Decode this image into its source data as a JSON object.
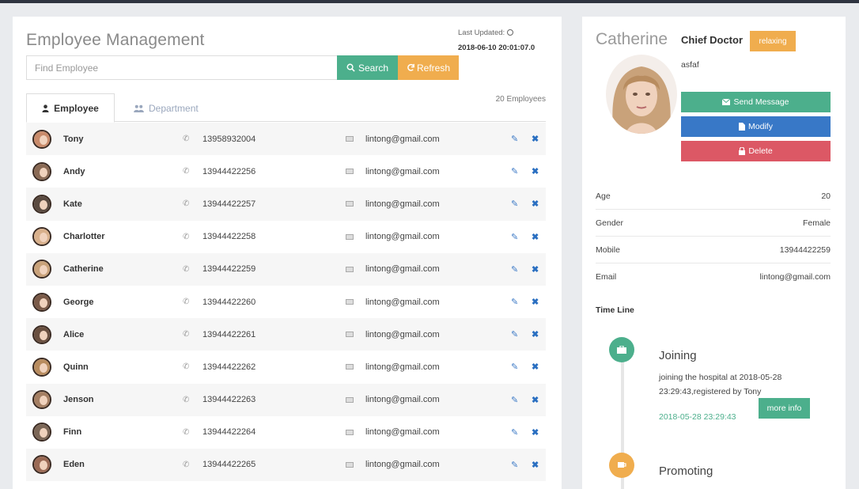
{
  "header": {
    "title": "Employee Management",
    "last_updated_label": "Last Updated:",
    "last_updated_time": "2018-06-10 20:01:07.0"
  },
  "search": {
    "placeholder": "Find Employee",
    "search_label": "Search",
    "refresh_label": "Refresh"
  },
  "tabs": {
    "employee": "Employee",
    "department": "Department",
    "count": "20 Employees"
  },
  "employees": [
    {
      "name": "Tony",
      "phone": "13958932004",
      "email": "lintong@gmail.com"
    },
    {
      "name": "Andy",
      "phone": "13944422256",
      "email": "lintong@gmail.com"
    },
    {
      "name": "Kate",
      "phone": "13944422257",
      "email": "lintong@gmail.com"
    },
    {
      "name": "Charlotter",
      "phone": "13944422258",
      "email": "lintong@gmail.com"
    },
    {
      "name": "Catherine",
      "phone": "13944422259",
      "email": "lintong@gmail.com"
    },
    {
      "name": "George",
      "phone": "13944422260",
      "email": "lintong@gmail.com"
    },
    {
      "name": "Alice",
      "phone": "13944422261",
      "email": "lintong@gmail.com"
    },
    {
      "name": "Quinn",
      "phone": "13944422262",
      "email": "lintong@gmail.com"
    },
    {
      "name": "Jenson",
      "phone": "13944422263",
      "email": "lintong@gmail.com"
    },
    {
      "name": "Finn",
      "phone": "13944422264",
      "email": "lintong@gmail.com"
    },
    {
      "name": "Eden",
      "phone": "13944422265",
      "email": "lintong@gmail.com"
    }
  ],
  "profile": {
    "name": "Catherine",
    "role": "Chief Doctor",
    "status": "relaxing",
    "note": "asfaf",
    "send_label": "Send Message",
    "modify_label": "Modify",
    "delete_label": "Delete",
    "details": [
      {
        "label": "Age",
        "value": "20"
      },
      {
        "label": "Gender",
        "value": "Female"
      },
      {
        "label": "Mobile",
        "value": "13944422259"
      },
      {
        "label": "Email",
        "value": "lintong@gmail.com"
      }
    ]
  },
  "timeline": {
    "title": "Time Line",
    "events": [
      {
        "heading": "Joining",
        "text": "joining the hospital at 2018-05-28 23:29:43,registered by Tony",
        "date": "2018-05-28 23:29:43",
        "more_label": "more info"
      },
      {
        "heading": "Promoting"
      }
    ]
  },
  "colors": {
    "green": "#4caf8c",
    "orange": "#f0ad4e",
    "blue": "#3878c7",
    "red": "#dc5865"
  },
  "icons": {
    "phone": "phone-icon",
    "email": "envelope-icon",
    "edit": "edit-icon",
    "delete": "close-icon"
  }
}
